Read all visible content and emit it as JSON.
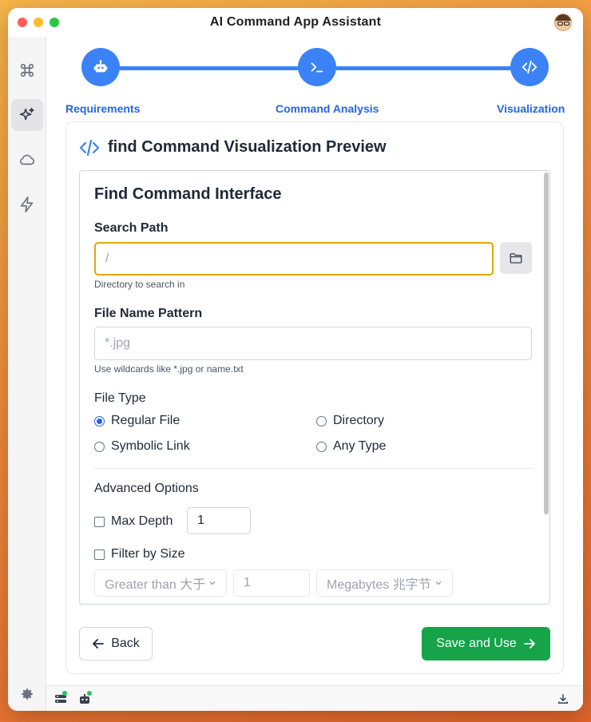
{
  "window": {
    "title": "AI Command App Assistant"
  },
  "sidebar": {
    "items": [
      {
        "icon": "command-icon"
      },
      {
        "icon": "sparkles-icon",
        "active": true
      },
      {
        "icon": "cloud-icon"
      },
      {
        "icon": "lightning-icon"
      }
    ],
    "footer_icon": "gear-icon"
  },
  "stepper": {
    "steps": [
      {
        "label": "Requirements",
        "icon": "robot-icon"
      },
      {
        "label": "Command Analysis",
        "icon": "terminal-icon"
      },
      {
        "label": "Visualization",
        "icon": "code-icon"
      }
    ]
  },
  "card": {
    "title": "find Command Visualization Preview",
    "icon": "code-icon"
  },
  "form": {
    "heading": "Find Command Interface",
    "search_path": {
      "label": "Search Path",
      "placeholder": "/",
      "help": "Directory to search in"
    },
    "file_name_pattern": {
      "label": "File Name Pattern",
      "placeholder": "*.jpg",
      "help": "Use wildcards like *.jpg or name.txt"
    },
    "file_type": {
      "label": "File Type",
      "options": [
        {
          "label": "Regular File",
          "checked": true
        },
        {
          "label": "Directory",
          "checked": false
        },
        {
          "label": "Symbolic Link",
          "checked": false
        },
        {
          "label": "Any Type",
          "checked": false
        }
      ]
    },
    "advanced": {
      "label": "Advanced Options",
      "max_depth": {
        "label": "Max Depth",
        "checked": false,
        "value": "1"
      },
      "filter_by_size": {
        "label": "Filter by Size",
        "checked": false,
        "comparison": "Greater than 大于",
        "value": "1",
        "unit": "Megabytes 兆字节"
      }
    }
  },
  "actions": {
    "back": "Back",
    "save": "Save and Use"
  },
  "colors": {
    "accent": "#3b82f6",
    "save": "#16a34a",
    "focus": "#e5a50a"
  }
}
